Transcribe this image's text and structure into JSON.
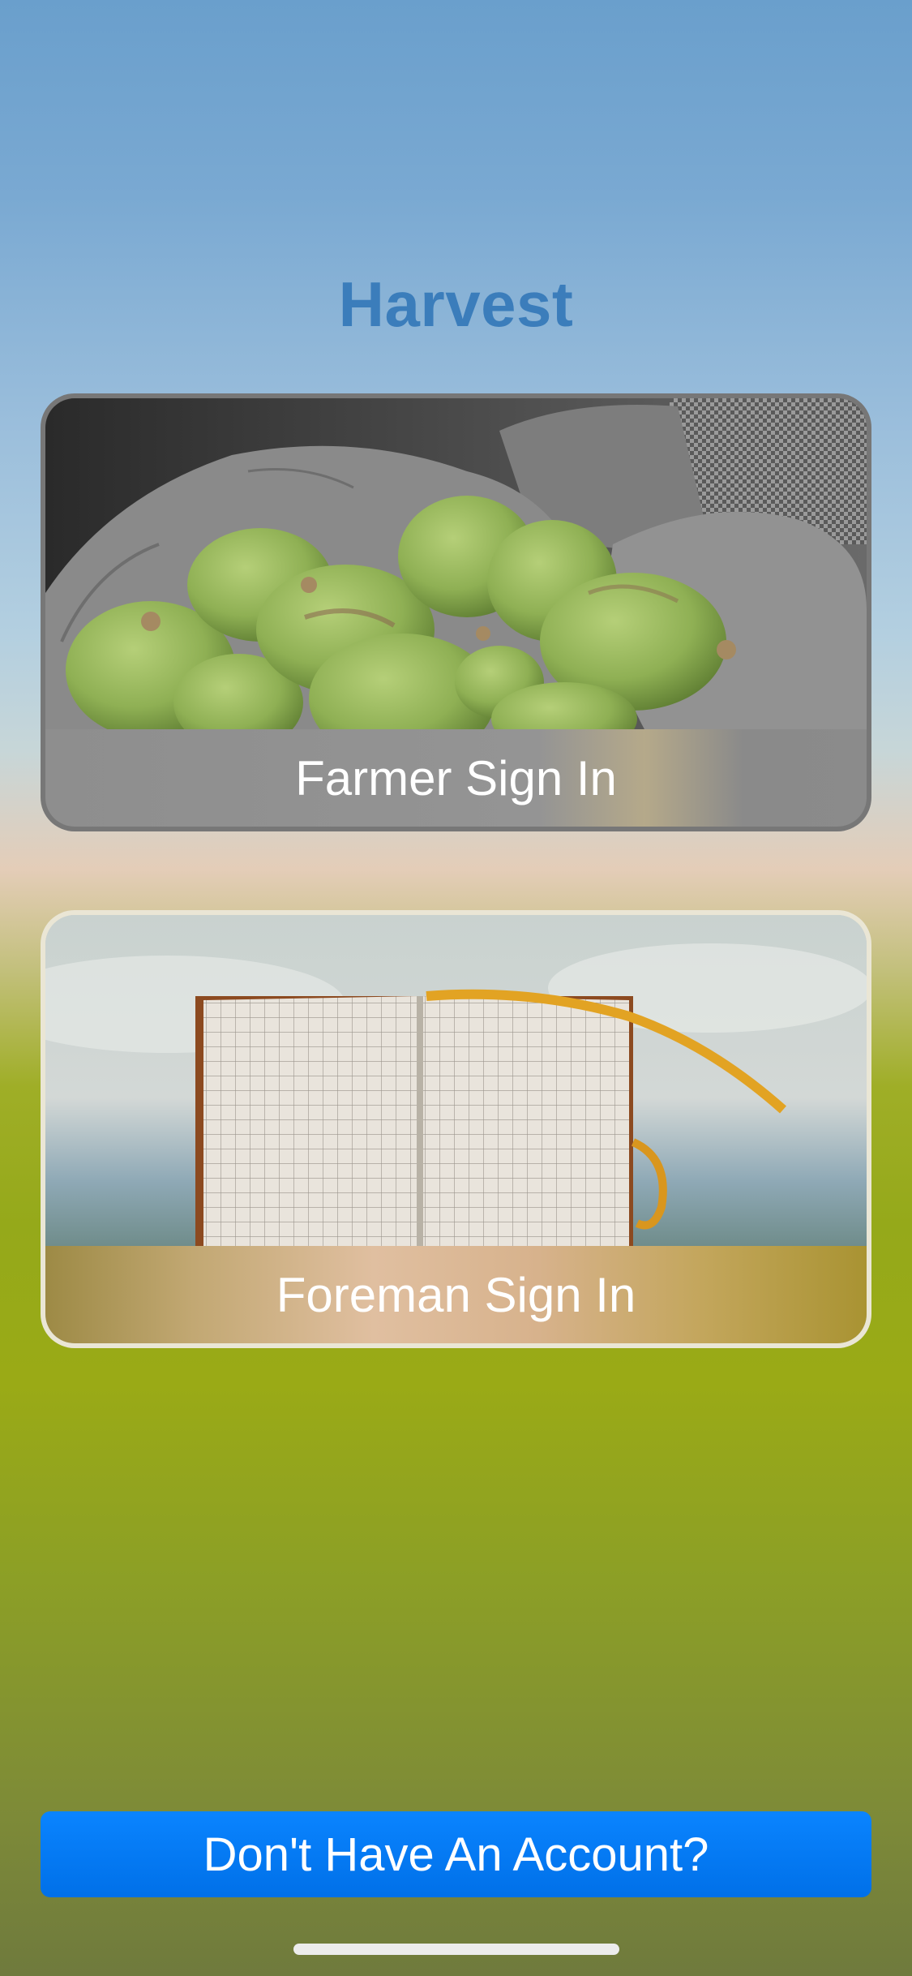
{
  "app": {
    "title": "Harvest"
  },
  "cards": [
    {
      "label": "Farmer Sign In",
      "image_icon": "macadamia-nuts-in-hands-photo"
    },
    {
      "label": "Foreman Sign In",
      "image_icon": "open-grid-notebook-photo"
    }
  ],
  "footer": {
    "signup_label": "Don't Have An Account?"
  },
  "colors": {
    "title": "#3b7dbb",
    "button": "#0a84ff",
    "label_text": "#ffffff"
  }
}
